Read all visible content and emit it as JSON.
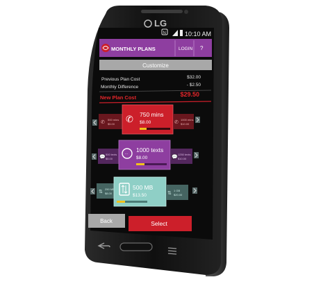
{
  "device": {
    "brand": "LG",
    "colors": {
      "body": "#161616",
      "screen": "#0b0b0b"
    }
  },
  "status_bar": {
    "time": "10:10 AM",
    "nfc_label": "N"
  },
  "header": {
    "title": "MONTHLY PLANS",
    "login_label": "LOGIN",
    "help_label": "?",
    "color": "#8e3ea0"
  },
  "customize": {
    "label": "Customize",
    "color": "#a8a8a8"
  },
  "cost_summary": {
    "previous_label": "Previous Plan Cost",
    "previous_value": "$32.00",
    "difference_label": "Monthly Difference",
    "difference_value": "- $2.50",
    "new_label": "New Plan Cost",
    "new_value": "$29.50",
    "new_color": "#e3262a"
  },
  "carousels": {
    "minutes": {
      "color": "#cc1f2a",
      "selected": {
        "title": "750 mins",
        "price": "$8.00",
        "icon": "phone-icon"
      },
      "left": {
        "title": "500 mins",
        "price": "$5.00"
      },
      "right": {
        "title": "1000 mins",
        "price": "$10.00"
      }
    },
    "texts": {
      "color": "#8e3ea0",
      "selected": {
        "title": "1000 texts",
        "price": "$8.00",
        "icon": "chat-bubble-icon"
      },
      "left": {
        "title": "500 texts",
        "price": "$5.00"
      },
      "right": {
        "title": "1250 texts",
        "price": "$10.00"
      }
    },
    "data": {
      "color": "#8fcfc6",
      "selected": {
        "title": "500 MB",
        "price": "$13.50",
        "icon": "data-transfer-icon"
      },
      "left": {
        "title": "250 MB",
        "price": "$8.00"
      },
      "right": {
        "title": "1 GB",
        "price": "$20.00"
      }
    }
  },
  "actions": {
    "back_label": "Back",
    "select_label": "Select",
    "back_color": "#a8a8a8",
    "select_color": "#cc1f2a"
  },
  "nav": {
    "back_icon": "back-arrow-icon",
    "home_icon": "home-button",
    "menu_icon": "menu-icon"
  }
}
